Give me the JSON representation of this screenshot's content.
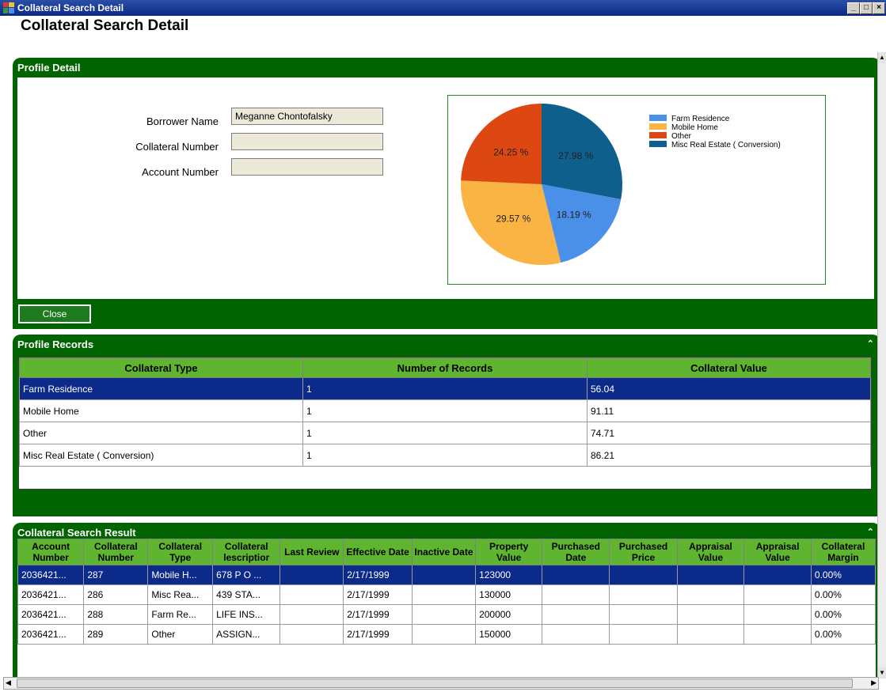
{
  "window": {
    "title": "Collateral Search Detail"
  },
  "page_title": "Collateral Search Detail",
  "colors": {
    "panel_green": "#006400",
    "header_green": "#5fb530",
    "selection_blue": "#0b2a8a"
  },
  "profile_detail": {
    "header": "Profile Detail",
    "borrower_label": "Borrower Name",
    "borrower_value": "Meganne Chontofalsky",
    "collateral_label": "Collateral Number",
    "collateral_value": "",
    "account_label": "Account Number",
    "account_value": "",
    "close_label": "Close"
  },
  "chart_data": {
    "type": "pie",
    "series": [
      {
        "name": "Farm Residence",
        "value": 18.19,
        "label": "18.19 %",
        "color": "#4a90e8"
      },
      {
        "name": "Mobile Home",
        "value": 29.57,
        "label": "29.57 %",
        "color": "#f9b443"
      },
      {
        "name": "Other",
        "value": 24.25,
        "label": "24.25 %",
        "color": "#dc4712"
      },
      {
        "name": "Misc Real Estate ( Conversion)",
        "value": 27.98,
        "label": "27.98 %",
        "color": "#0f5f8c"
      }
    ],
    "legend": "right"
  },
  "profile_records": {
    "header": "Profile Records",
    "columns": [
      "Collateral Type",
      "Number of Records",
      "Collateral Value"
    ],
    "rows": [
      [
        "Farm Residence",
        "1",
        "56.04"
      ],
      [
        "Mobile Home",
        "1",
        "91.11"
      ],
      [
        "Other",
        "1",
        "74.71"
      ],
      [
        "Misc Real Estate ( Conversion)",
        "1",
        "86.21"
      ]
    ]
  },
  "search_result": {
    "header": "Collateral Search Result",
    "columns": [
      "Account Number",
      "Collateral Number",
      "Collateral Type",
      "Collateral lescriptior",
      "Last Review",
      "Effective Date",
      "Inactive Date",
      "Property Value",
      "Purchased Date",
      "Purchased Price",
      "Appraisal Value",
      "Appraisal Value",
      "Collateral Margin"
    ],
    "rows": [
      [
        "2036421...",
        "287",
        "Mobile H...",
        "678 P O ...",
        "",
        "2/17/1999",
        "",
        "123000",
        "",
        "",
        "",
        "",
        "0.00%"
      ],
      [
        "2036421...",
        "286",
        "Misc Rea...",
        "439 STA...",
        "",
        "2/17/1999",
        "",
        "130000",
        "",
        "",
        "",
        "",
        "0.00%"
      ],
      [
        "2036421...",
        "288",
        "Farm Re...",
        "LIFE INS...",
        "",
        "2/17/1999",
        "",
        "200000",
        "",
        "",
        "",
        "",
        "0.00%"
      ],
      [
        "2036421...",
        "289",
        "Other",
        "ASSIGN...",
        "",
        "2/17/1999",
        "",
        "150000",
        "",
        "",
        "",
        "",
        "0.00%"
      ]
    ]
  }
}
